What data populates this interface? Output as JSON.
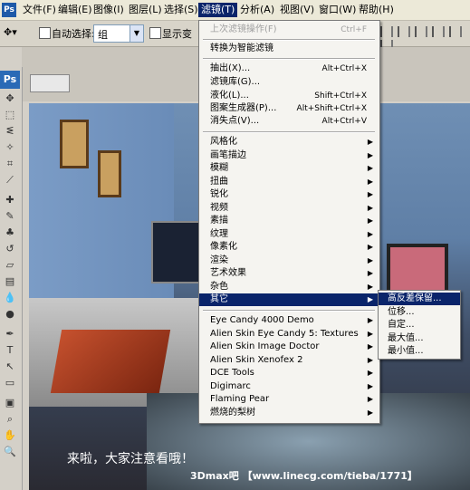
{
  "menubar": {
    "items": [
      "文件(F)",
      "编辑(E)",
      "图像(I)",
      "图层(L)",
      "选择(S)",
      "滤镜(T)",
      "分析(A)",
      "视图(V)",
      "窗口(W)",
      "帮助(H)"
    ],
    "active": "滤镜(T)"
  },
  "options": {
    "auto_select_label": "自动选择:",
    "auto_select_value": "组",
    "show_transform_label": "显示变"
  },
  "toolbox": {
    "badge": "Ps"
  },
  "filter_menu": {
    "last_filter": {
      "label": "上次滤镜操作(F)",
      "shortcut": "Ctrl+F"
    },
    "convert_smart": "转换为智能滤镜",
    "group1": [
      {
        "label": "抽出(X)...",
        "shortcut": "Alt+Ctrl+X"
      },
      {
        "label": "滤镜库(G)...",
        "shortcut": ""
      },
      {
        "label": "液化(L)...",
        "shortcut": "Shift+Ctrl+X"
      },
      {
        "label": "图案生成器(P)...",
        "shortcut": "Alt+Shift+Ctrl+X"
      },
      {
        "label": "消失点(V)...",
        "shortcut": "Alt+Ctrl+V"
      }
    ],
    "group2": [
      "风格化",
      "画笔描边",
      "模糊",
      "扭曲",
      "锐化",
      "视频",
      "素描",
      "纹理",
      "像素化",
      "渲染",
      "艺术效果",
      "杂色",
      "其它"
    ],
    "group3": [
      "Eye Candy 4000 Demo",
      "Alien Skin Eye Candy 5: Textures",
      "Alien Skin Image Doctor",
      "Alien Skin Xenofex 2",
      "DCE Tools",
      "Digimarc",
      "Flaming Pear",
      "燃烧的梨树"
    ]
  },
  "submenu": {
    "items": [
      "高反差保留...",
      "位移...",
      "自定...",
      "最大值...",
      "最小值..."
    ],
    "active": "高反差保留..."
  },
  "canvas": {
    "overlay_text": "来啦，大家注意看哦！",
    "watermark": "3Dmax吧 【www.linecg.com/tieba/1771】"
  }
}
